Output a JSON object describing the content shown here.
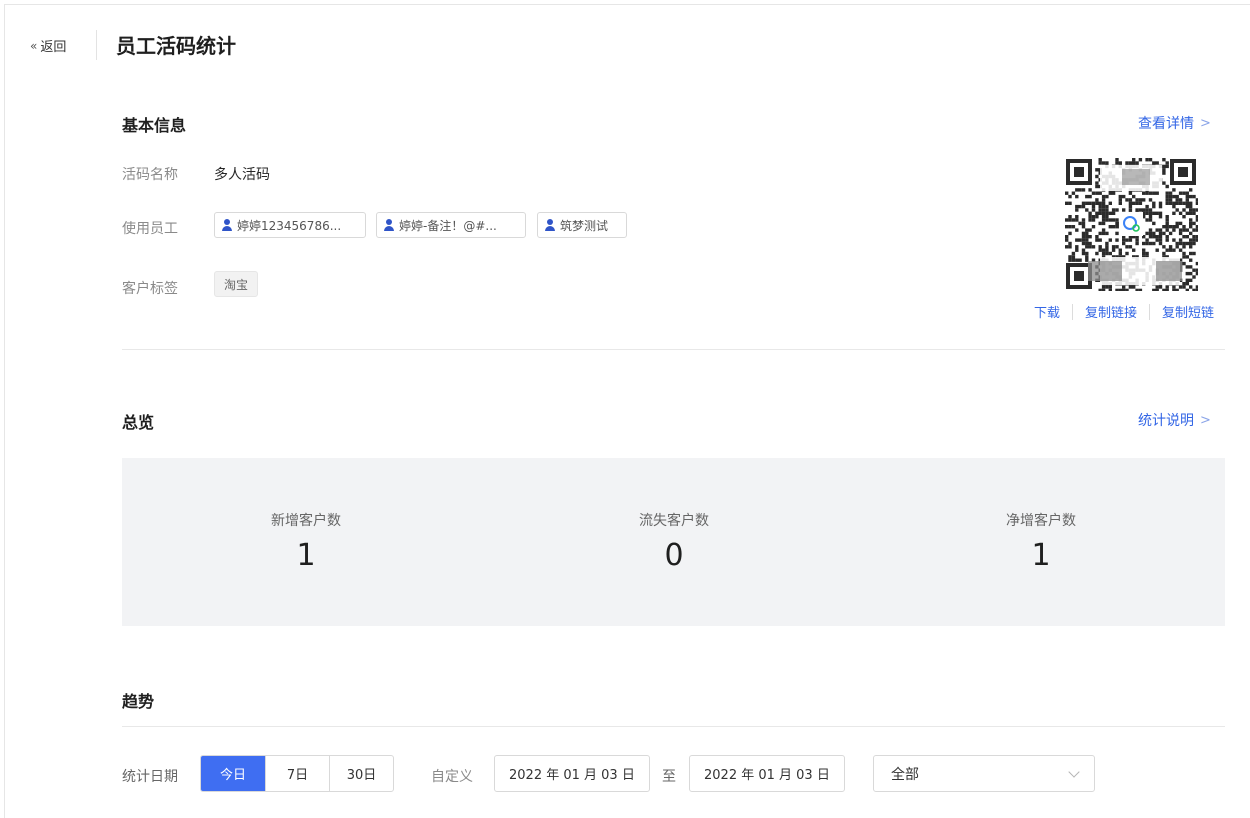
{
  "header": {
    "back_label": "返回",
    "title": "员工活码统计"
  },
  "basic_info": {
    "title": "基本信息",
    "detail_link": "查看详情",
    "code_name_label": "活码名称",
    "code_name_value": "多人活码",
    "staff_label": "使用员工",
    "staff": [
      "婷婷123456786...",
      "婷婷-备注！@#...",
      "筑梦测试"
    ],
    "customer_tag_label": "客户标签",
    "customer_tag": "淘宝",
    "qr_actions": {
      "download": "下载",
      "copy_link": "复制链接",
      "copy_short_link": "复制短链"
    }
  },
  "overview": {
    "title": "总览",
    "help_link": "统计说明",
    "stats": [
      {
        "label": "新增客户数",
        "value": "1"
      },
      {
        "label": "流失客户数",
        "value": "0"
      },
      {
        "label": "净增客户数",
        "value": "1"
      }
    ]
  },
  "trend": {
    "title": "趋势",
    "date_label": "统计日期",
    "ranges": [
      "今日",
      "7日",
      "30日"
    ],
    "active_range": "今日",
    "custom_label": "自定义",
    "start_date": "2022 年 01 月 03 日",
    "to_label": "至",
    "end_date": "2022 年 01 月 03 日",
    "filter_value": "全部"
  },
  "colors": {
    "accent": "#3f6ef2",
    "link": "#3366e6",
    "stats_bg": "#f2f3f5"
  },
  "icons": {
    "back": "double-chevron-left-icon",
    "person": "person-icon",
    "arrow": "chevron-right-icon",
    "dropdown": "chevron-down-icon"
  }
}
